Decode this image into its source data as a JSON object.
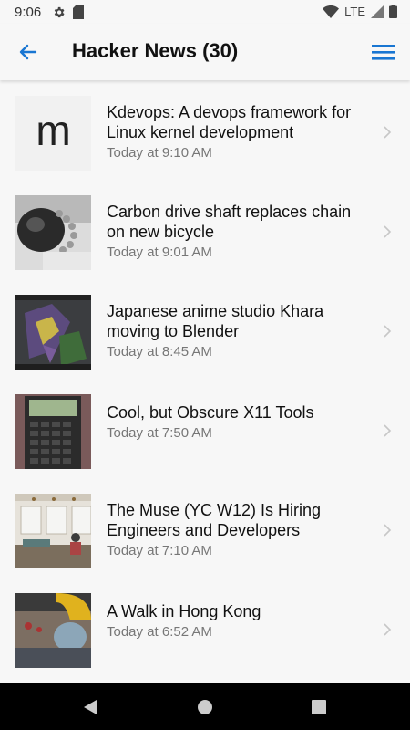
{
  "status_bar": {
    "time": "9:06",
    "network": "LTE",
    "icons": [
      "gear-icon",
      "sd-card-icon",
      "wifi-icon",
      "signal-icon",
      "battery-icon"
    ]
  },
  "app_bar": {
    "title": "Hacker News (30)",
    "back_icon": "back-arrow-icon",
    "menu_icon": "hamburger-menu-icon",
    "accent": "#1976d2"
  },
  "feed": {
    "items": [
      {
        "title": "Kdevops: A devops framework for Linux kernel development",
        "time": "Today at 9:10 AM",
        "thumb_letter": "m"
      },
      {
        "title": "Carbon drive shaft replaces chain on new bicycle",
        "time": "Today at 9:01 AM"
      },
      {
        "title": "Japanese anime studio Khara moving to Blender",
        "time": "Today at 8:45 AM"
      },
      {
        "title": "Cool, but Obscure X11 Tools",
        "time": "Today at 7:50 AM"
      },
      {
        "title": "The Muse (YC W12) Is Hiring Engineers and Developers",
        "time": "Today at 7:10 AM"
      },
      {
        "title": "A Walk in Hong Kong",
        "time": "Today at 6:52 AM"
      }
    ]
  },
  "nav_bar": {
    "icons": [
      "back-triangle-icon",
      "home-circle-icon",
      "recents-square-icon"
    ]
  }
}
